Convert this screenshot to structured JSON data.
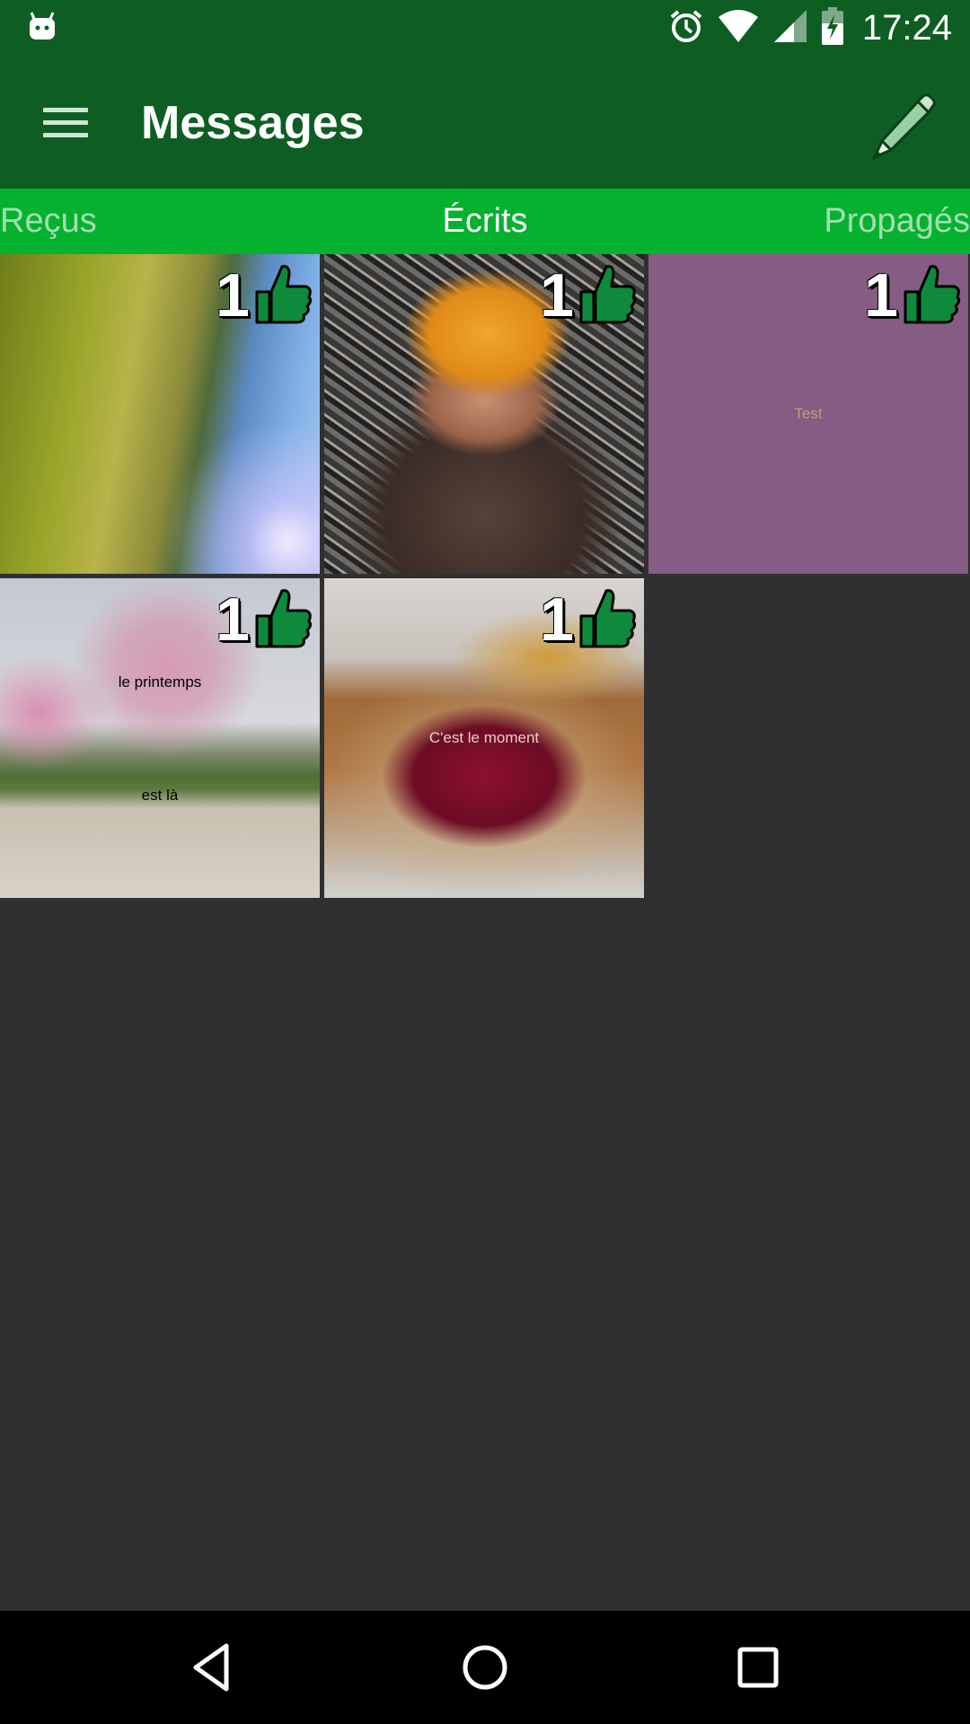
{
  "status_bar": {
    "time": "17:24",
    "icons": [
      "android-notification-icon",
      "alarm-icon",
      "wifi-icon",
      "signal-icon",
      "battery-charging-icon"
    ]
  },
  "app_bar": {
    "title": "Messages",
    "menu_icon": "hamburger-menu-icon",
    "action_icon": "pencil-icon"
  },
  "tabs": [
    {
      "label": "Reçus",
      "active": false
    },
    {
      "label": "Écrits",
      "active": true
    },
    {
      "label": "Propagés",
      "active": false
    }
  ],
  "messages": [
    {
      "likes": "1",
      "text_lines": [],
      "background": "mossy-tree-photo"
    },
    {
      "likes": "1",
      "text_lines": [],
      "background": "child-in-orange-hat-photo"
    },
    {
      "likes": "1",
      "text_lines": [
        "Test"
      ],
      "background": "#855c83",
      "text_color": "#b7a46d"
    },
    {
      "likes": "1",
      "text_lines": [
        "le printemps",
        "est là"
      ],
      "background": "blossom-tree-photo",
      "text_color": "#000000"
    },
    {
      "likes": "1",
      "text_lines": [
        "C'est le moment"
      ],
      "background": "cherries-bowl-photo",
      "text_color": "#e6d2c8"
    }
  ],
  "colors": {
    "primary_dark": "#0e5e23",
    "tab_bar": "#05b230",
    "like_icon": "#0f8a3c",
    "background": "#303030"
  },
  "nav_bar": {
    "icons": [
      "back-icon",
      "home-icon",
      "recents-icon"
    ]
  }
}
